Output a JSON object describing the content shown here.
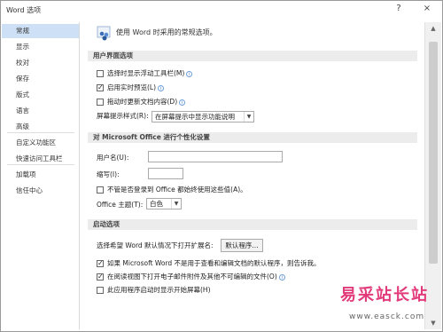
{
  "window": {
    "title": "Word 选项",
    "help": "?",
    "close": "×"
  },
  "sidebar": {
    "items": [
      {
        "label": "常规"
      },
      {
        "label": "显示"
      },
      {
        "label": "校对"
      },
      {
        "label": "保存"
      },
      {
        "label": "版式"
      },
      {
        "label": "语言"
      },
      {
        "label": "高级"
      },
      {
        "label": "自定义功能区"
      },
      {
        "label": "快速访问工具栏"
      },
      {
        "label": "加载项"
      },
      {
        "label": "信任中心"
      }
    ],
    "selected": "常规"
  },
  "main": {
    "intro": "使用 Word 时采用的常规选项。",
    "ui_section": {
      "header": "用户界面选项",
      "mini_toolbar": {
        "label": "选择时显示浮动工具栏(M)",
        "checked": false
      },
      "live_preview": {
        "label": "启用实时预览(L)",
        "checked": true
      },
      "update_drag": {
        "label": "拖动时更新文档内容(D)",
        "checked": false
      },
      "screentip_label": "屏幕提示样式(R):",
      "screentip_value": "在屏幕提示中显示功能说明"
    },
    "personal_section": {
      "header": "对 Microsoft Office 进行个性化设置",
      "username_label": "用户名(U):",
      "username_value": "",
      "initials_label": "缩写(I):",
      "initials_value": "",
      "always_use": {
        "label": "不管是否登录到 Office 都始终使用这些值(A)。",
        "checked": false
      },
      "theme_label": "Office 主题(T):",
      "theme_value": "白色"
    },
    "startup_section": {
      "header": "启动选项",
      "ext_label": "选择希望 Word 默认情况下打开扩展名:",
      "default_programs_button": "默认程序...",
      "tell_me": {
        "label": "如果 Microsoft Word 不是用于查看和编辑文档的默认程序，则告诉我。",
        "checked": true
      },
      "reading_view": {
        "label": "在阅读视图下打开电子邮件附件及其他不可编辑的文件(O)",
        "checked": true
      },
      "start_screen": {
        "label": "此应用程序启动时显示开始屏幕(H)",
        "checked": false
      }
    }
  },
  "watermark": {
    "text": "易采站长站",
    "url": "www.easck.com"
  },
  "colors": {
    "selected_bg": "#cde0f5",
    "section_bg": "#ececec",
    "watermark": "#e23a7a"
  }
}
